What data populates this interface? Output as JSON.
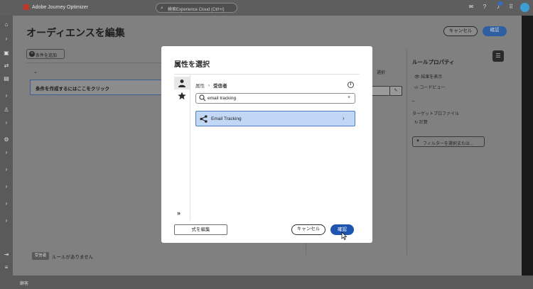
{
  "app": {
    "brand": "Adobe Journey Optimizer",
    "search_placeholder": "検索Experience Cloud (Ctrl+/)"
  },
  "page": {
    "title": "オーディエンスを編集",
    "cancel_label": "キャンセル",
    "confirm_label": "確認",
    "add_condition_label": "条件を追加",
    "rule_placeholder": "条件を作成するにはここをクリック",
    "select_hint": "選択",
    "right_panel": {
      "title": "ルールプロパティ",
      "show_results": "結果を表示",
      "code_view": "コードビュー",
      "dash": "–",
      "target_profiles": "ターゲットプロファイル",
      "calculate": "計算",
      "filter_placeholder": "フィルターを選択または..."
    },
    "status_badge": "受信者",
    "status_text": "ルールがありません",
    "footer_text": "顧客"
  },
  "modal": {
    "title": "属性を選択",
    "breadcrumb": {
      "root": "属性",
      "current": "受信者"
    },
    "search_value": "email tracking",
    "result_item": "Email Tracking",
    "expand_icon_glyph": "»",
    "expression_label": "式を編集",
    "cancel_label": "キャンセル",
    "confirm_label": "確認"
  },
  "colors": {
    "accent": "#1d55b0",
    "selected_row": "#c2d7f5",
    "selected_border": "#4a7fc4"
  }
}
